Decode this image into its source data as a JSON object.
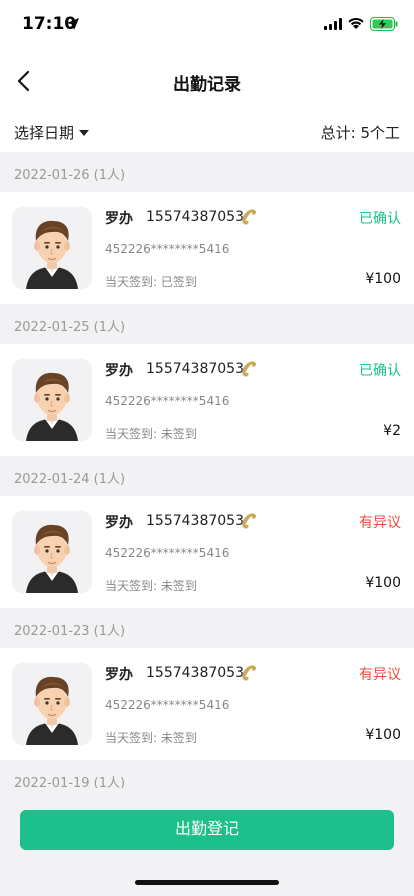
{
  "status_bar": {
    "time": "17:10"
  },
  "nav": {
    "title": "出勤记录"
  },
  "filter": {
    "date_label": "选择日期",
    "total_label": "总计: 5个工"
  },
  "colors": {
    "confirmed": "#1dbf8a",
    "disputed": "#ef4b3e",
    "button": "#1dbf8a"
  },
  "groups": [
    {
      "date": "2022-01-26 (1人)",
      "record": {
        "name": "罗办",
        "phone": "15574387053",
        "id": "452226********5416",
        "sign": "当天签到: 已签到",
        "status": "已确认",
        "status_type": "confirmed",
        "amount": "¥100"
      }
    },
    {
      "date": "2022-01-25 (1人)",
      "record": {
        "name": "罗办",
        "phone": "15574387053",
        "id": "452226********5416",
        "sign": "当天签到: 未签到",
        "status": "已确认",
        "status_type": "confirmed",
        "amount": "¥2"
      }
    },
    {
      "date": "2022-01-24 (1人)",
      "record": {
        "name": "罗办",
        "phone": "15574387053",
        "id": "452226********5416",
        "sign": "当天签到: 未签到",
        "status": "有异议",
        "status_type": "disputed",
        "amount": "¥100"
      }
    },
    {
      "date": "2022-01-23 (1人)",
      "record": {
        "name": "罗办",
        "phone": "15574387053",
        "id": "452226********5416",
        "sign": "当天签到: 未签到",
        "status": "有异议",
        "status_type": "disputed",
        "amount": "¥100"
      }
    },
    {
      "date": "2022-01-19 (1人)"
    }
  ],
  "footer": {
    "button_label": "出勤登记"
  }
}
